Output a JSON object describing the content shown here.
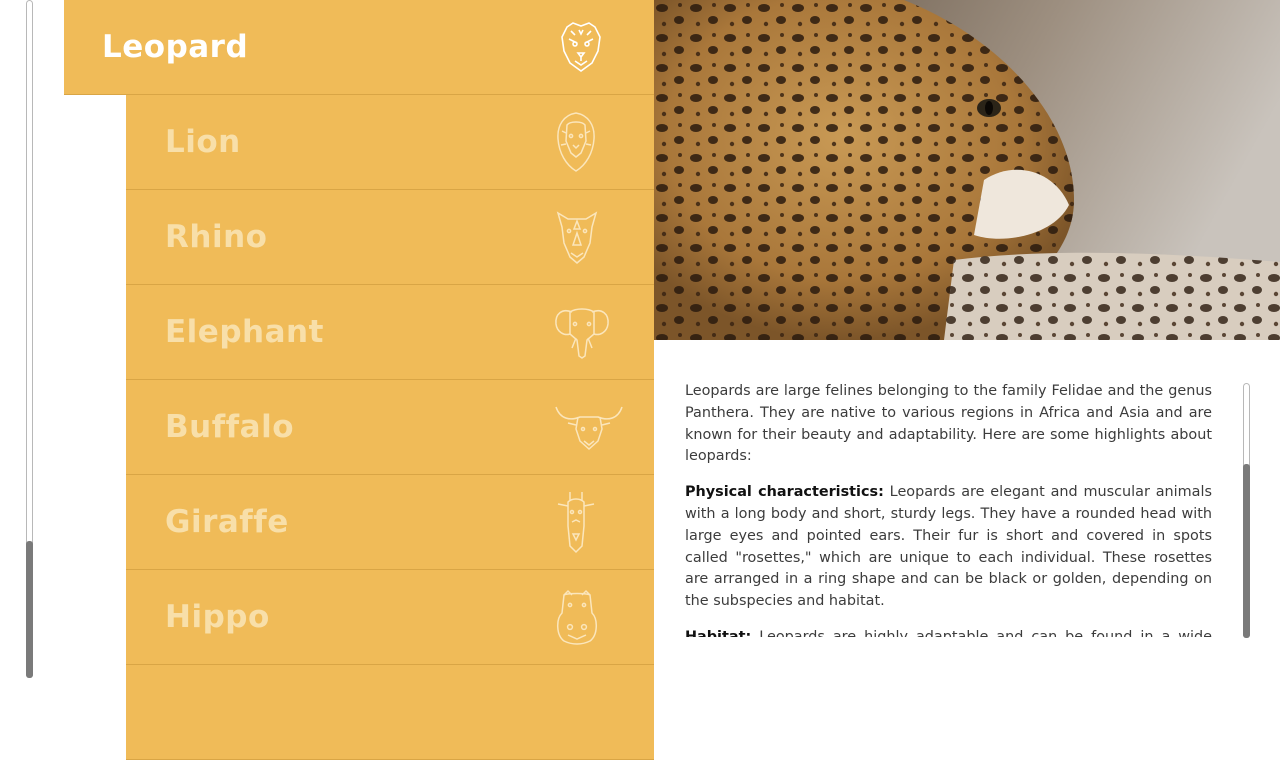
{
  "menu": {
    "active": {
      "label": "Leopard",
      "icon": "leopard-head-icon"
    },
    "items": [
      {
        "label": "Lion",
        "icon": "lion-head-icon"
      },
      {
        "label": "Rhino",
        "icon": "rhino-head-icon"
      },
      {
        "label": "Elephant",
        "icon": "elephant-head-icon"
      },
      {
        "label": "Buffalo",
        "icon": "buffalo-head-icon"
      },
      {
        "label": "Giraffe",
        "icon": "giraffe-head-icon"
      },
      {
        "label": "Hippo",
        "icon": "hippo-head-icon"
      }
    ]
  },
  "colors": {
    "menu_bg": "#f0bb58",
    "active_text": "#ffffff",
    "inactive_text": "#f8dfa9"
  },
  "article": {
    "intro": "Leopards are large felines belonging to the family Felidae and the genus Panthera. They are native to various regions in Africa and Asia and are known for their beauty and adaptability. Here are some highlights about leopards:",
    "physical_heading": "Physical characteristics:",
    "physical_text": " Leopards are elegant and muscular animals with a long body and short, sturdy legs. They have a rounded head with large eyes and pointed ears. Their fur is short and covered in spots called \"rosettes,\" which are unique to each individual. These rosettes are arranged in a ring shape and can be black or golden, depending on the subspecies and habitat.",
    "habitat_heading": "Habitat:",
    "habitat_text": " Leopards are highly adaptable and can be found in a wide range"
  }
}
